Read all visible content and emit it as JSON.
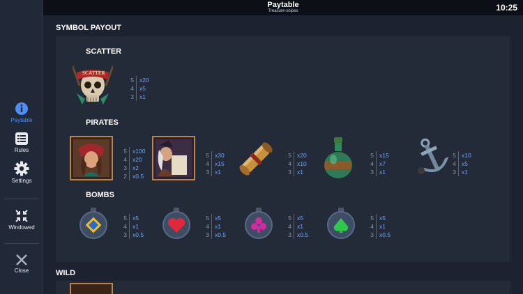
{
  "topbar": {
    "title": "Paytable",
    "subtitle": "Treasure-snipes",
    "clock": "10:25"
  },
  "sidebar": {
    "paytable": "Paytable",
    "rules": "Rules",
    "settings": "Settings",
    "windowed": "Windowed",
    "close": "Close"
  },
  "sections": {
    "symbol_payout": "SYMBOL PAYOUT",
    "wild": "WILD"
  },
  "groups": {
    "scatter": {
      "title": "SCATTER",
      "items": [
        {
          "name": "scatter-skull",
          "label": "SCATTER",
          "pays": [
            [
              "5",
              "x20"
            ],
            [
              "4",
              "x5"
            ],
            [
              "3",
              "x1"
            ]
          ]
        }
      ]
    },
    "pirates": {
      "title": "PIRATES",
      "items": [
        {
          "name": "pirate-woman",
          "pays": [
            [
              "5",
              "x100"
            ],
            [
              "4",
              "x20"
            ],
            [
              "3",
              "x2"
            ],
            [
              "2",
              "x0.5"
            ]
          ]
        },
        {
          "name": "pirate-captain",
          "pays": [
            [
              "5",
              "x30"
            ],
            [
              "4",
              "x15"
            ],
            [
              "3",
              "x1"
            ]
          ]
        },
        {
          "name": "scroll",
          "pays": [
            [
              "5",
              "x20"
            ],
            [
              "4",
              "x10"
            ],
            [
              "3",
              "x1"
            ]
          ]
        },
        {
          "name": "potion-bottle",
          "pays": [
            [
              "5",
              "x15"
            ],
            [
              "4",
              "x7"
            ],
            [
              "3",
              "x1"
            ]
          ]
        },
        {
          "name": "anchor",
          "pays": [
            [
              "5",
              "x10"
            ],
            [
              "4",
              "x5"
            ],
            [
              "3",
              "x1"
            ]
          ]
        }
      ]
    },
    "bombs": {
      "title": "BOMBS",
      "items": [
        {
          "name": "bomb-diamond",
          "pays": [
            [
              "5",
              "x5"
            ],
            [
              "4",
              "x1"
            ],
            [
              "3",
              "x0.5"
            ]
          ]
        },
        {
          "name": "bomb-heart",
          "pays": [
            [
              "5",
              "x5"
            ],
            [
              "4",
              "x1"
            ],
            [
              "3",
              "x0.5"
            ]
          ]
        },
        {
          "name": "bomb-club",
          "pays": [
            [
              "5",
              "x5"
            ],
            [
              "4",
              "x1"
            ],
            [
              "3",
              "x0.5"
            ]
          ]
        },
        {
          "name": "bomb-spade",
          "pays": [
            [
              "5",
              "x5"
            ],
            [
              "4",
              "x1"
            ],
            [
              "3",
              "x0.5"
            ]
          ]
        }
      ]
    }
  },
  "colors": {
    "accent": "#4f8ef7",
    "payout_value": "#6fa4ff",
    "panel": "#232a38",
    "background": "#1c2230"
  }
}
